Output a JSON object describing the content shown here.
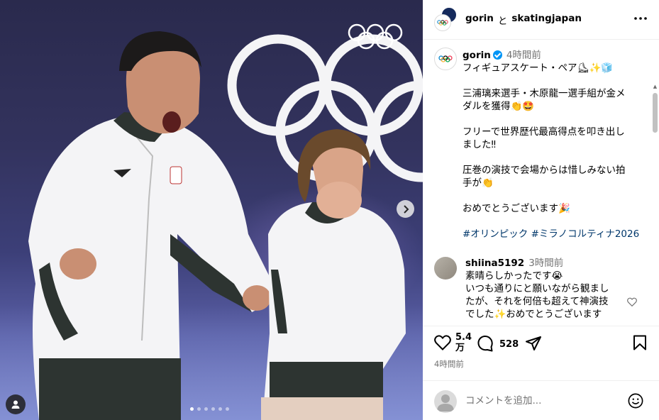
{
  "header": {
    "user1": "gorin",
    "and": "と",
    "user2": "skatingjapan"
  },
  "post": {
    "username": "gorin",
    "time": "4時間前",
    "caption_lines": [
      "フィギュアスケート・ペア⛸✨🧊",
      "",
      "三浦璃来選手・木原龍一選手組が金メ",
      "ダルを獲得👏🤩",
      "",
      "フリーで世界歴代最高得点を叩き出し",
      "ました‼",
      "",
      "圧巻の演技で会場からは惜しみない拍",
      "手が👏",
      "",
      "おめでとうございます🎉"
    ],
    "hashtags": "#オリンピック #ミラノコルティナ2026"
  },
  "comment": {
    "username": "shiina5192",
    "time": "3時間前",
    "lines": [
      "素晴らしかったです😭",
      "いつも通りにと願いながら観まし",
      "たが、それを何倍も超えて神演技",
      "でした✨おめでとうございます"
    ]
  },
  "actions": {
    "likes": "5.4",
    "likes_unit": "万",
    "comments": "528",
    "timestamp": "4時間前"
  },
  "add_comment": {
    "placeholder": "コメントを追加..."
  },
  "carousel": {
    "dot_count": 6,
    "active_index": 0
  },
  "icons": {
    "more": "more-icon",
    "heart": "heart-icon",
    "comment": "comment-icon",
    "share": "share-icon",
    "save": "bookmark-icon",
    "emoji": "emoji-icon",
    "next": "chevron-right-icon",
    "user_tag": "user-tag-icon"
  },
  "colors": {
    "verified": "#0095f6",
    "hashtag": "#00376b",
    "muted": "#737373"
  }
}
